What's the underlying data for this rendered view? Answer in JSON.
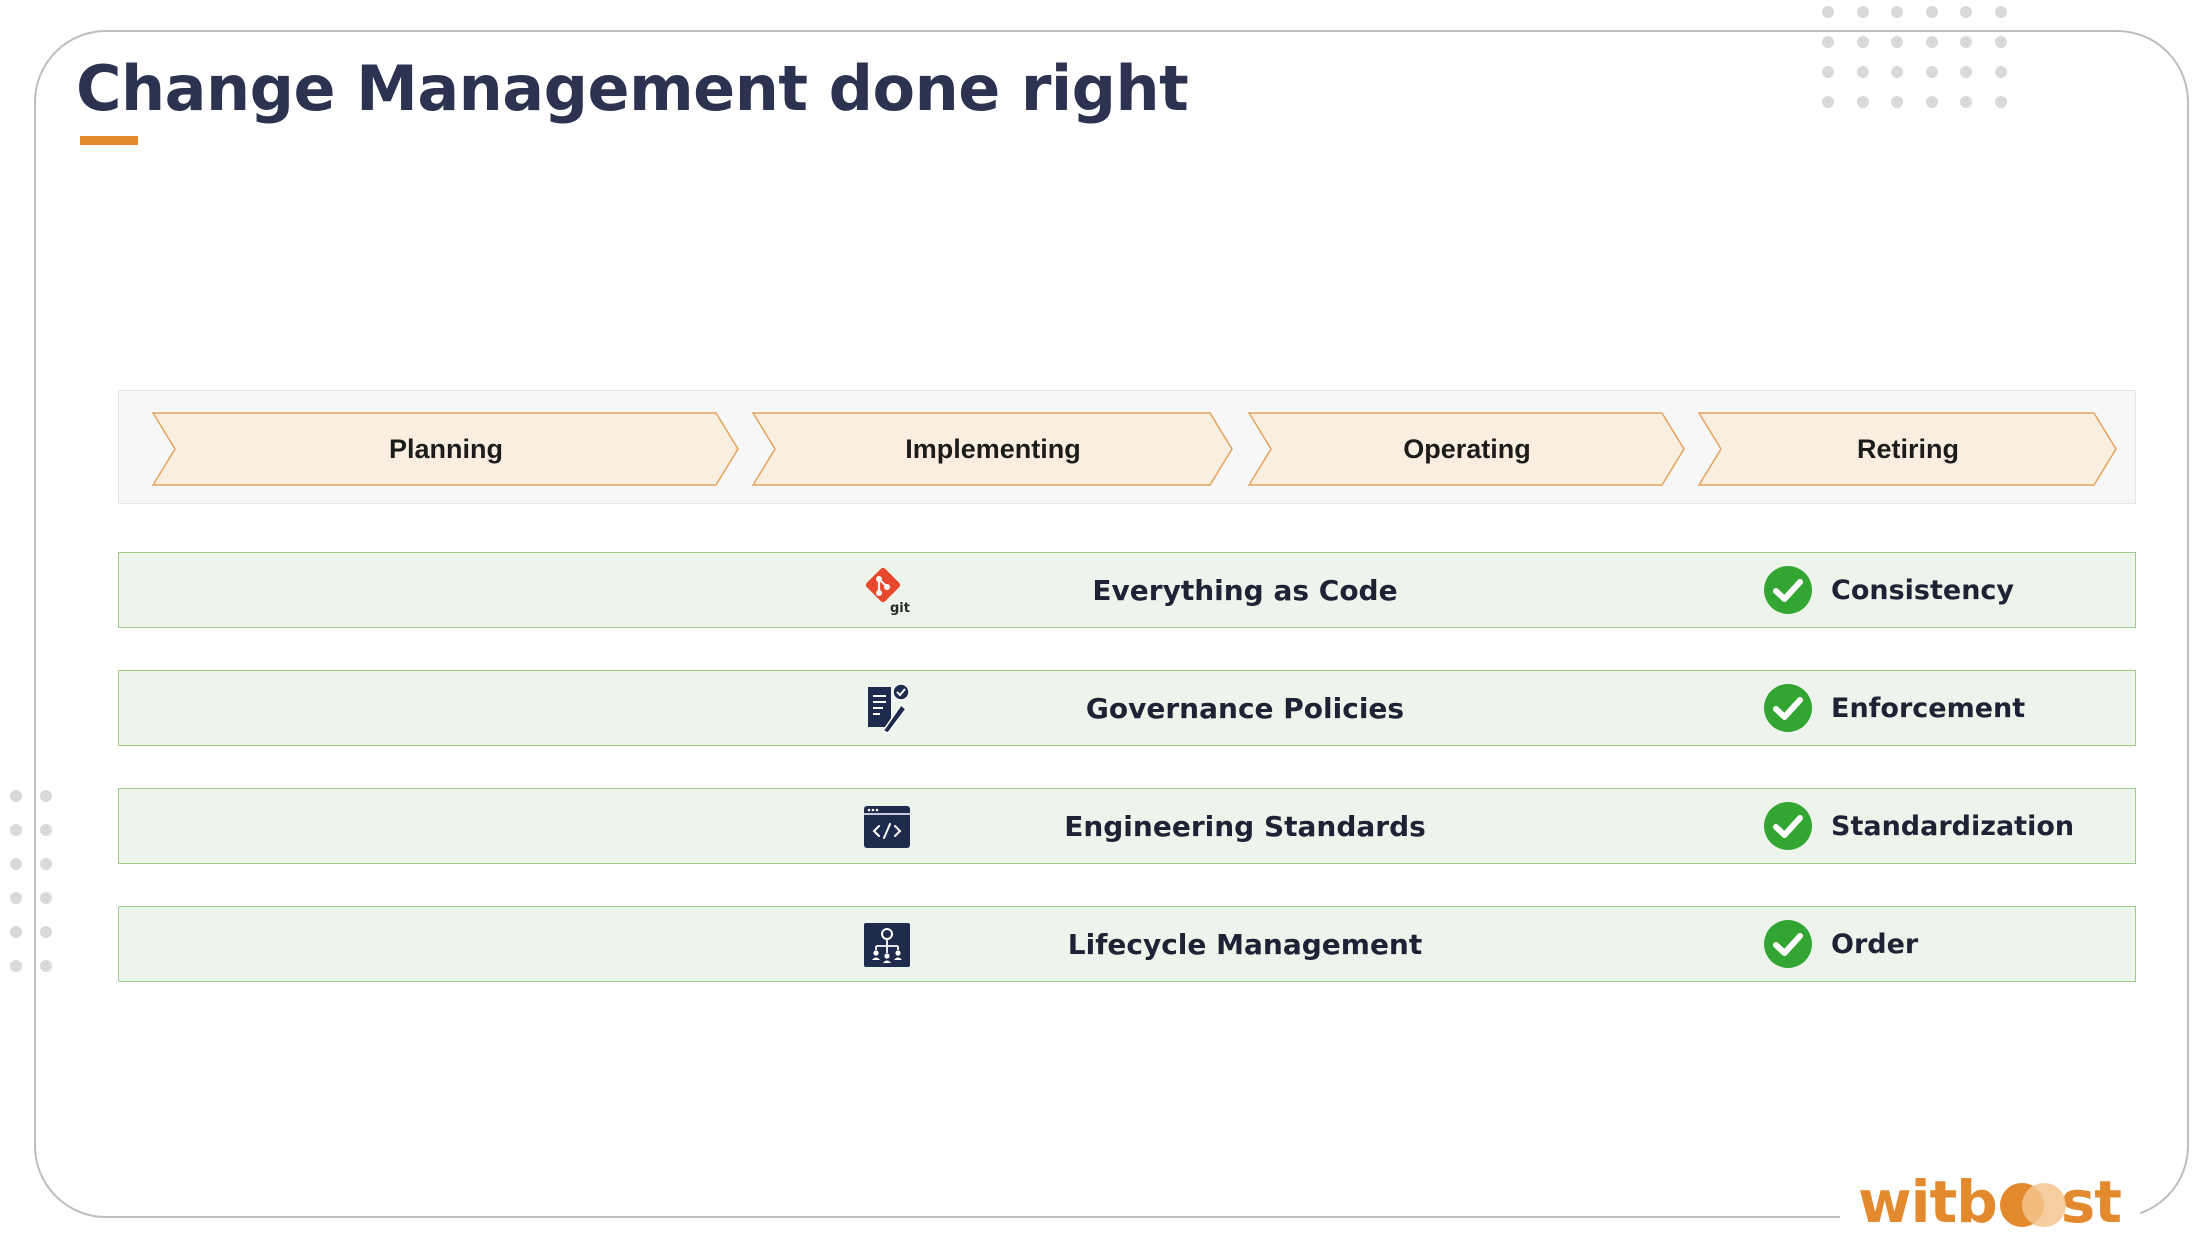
{
  "slide": {
    "title": "Change Management done right"
  },
  "phases": [
    {
      "label": "Planning"
    },
    {
      "label": "Implementing"
    },
    {
      "label": "Operating"
    },
    {
      "label": "Retiring"
    }
  ],
  "pillars": [
    {
      "title": "Everything as Code",
      "icon": "git-icon",
      "benefit": "Consistency"
    },
    {
      "title": "Governance Policies",
      "icon": "policy-document-icon",
      "benefit": "Enforcement"
    },
    {
      "title": "Engineering Standards",
      "icon": "code-window-icon",
      "benefit": "Standardization"
    },
    {
      "title": "Lifecycle Management",
      "icon": "org-hierarchy-icon",
      "benefit": "Order"
    }
  ],
  "colors": {
    "title": "#2c3350",
    "accent_orange": "#e28a2d",
    "chevron_fill": "#faeee1",
    "row_fill": "#edf4ec",
    "row_border": "#9fcb8c",
    "check_green": "#33a532",
    "icon_navy": "#1e2b4d",
    "git_red": "#e8492e"
  },
  "brand": {
    "logo_text_pre": "witb",
    "logo_text_post": "st"
  }
}
